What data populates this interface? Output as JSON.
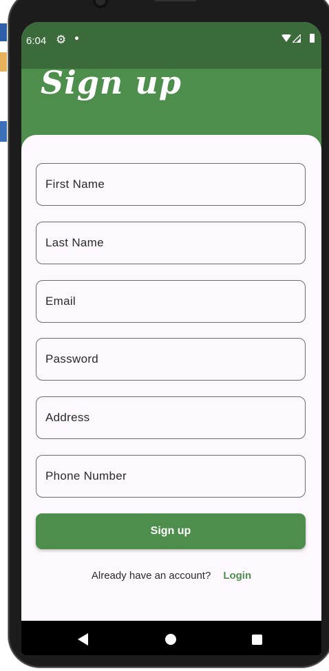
{
  "status_bar": {
    "time": "6:04",
    "icons": [
      "gear-icon",
      "notification-dot-icon",
      "wifi-icon",
      "signal-icon",
      "battery-icon"
    ]
  },
  "header": {
    "title": "Sign up"
  },
  "form": {
    "fields": [
      {
        "name": "first-name",
        "placeholder": "First Name",
        "value": ""
      },
      {
        "name": "last-name",
        "placeholder": "Last Name",
        "value": ""
      },
      {
        "name": "email",
        "placeholder": "Email",
        "value": ""
      },
      {
        "name": "password",
        "placeholder": "Password",
        "value": ""
      },
      {
        "name": "address",
        "placeholder": "Address",
        "value": ""
      },
      {
        "name": "phone-number",
        "placeholder": "Phone Number",
        "value": ""
      }
    ],
    "submit_label": "Sign up"
  },
  "footer": {
    "prompt_text": "Already have an account?",
    "login_label": "Login"
  },
  "nav_bar": {
    "icons": [
      "back-icon",
      "home-icon",
      "recent-apps-icon"
    ]
  },
  "colors": {
    "accent": "#4e8e4c",
    "status_bar": "#3b6b3b",
    "surface": "#fdf8fd"
  }
}
